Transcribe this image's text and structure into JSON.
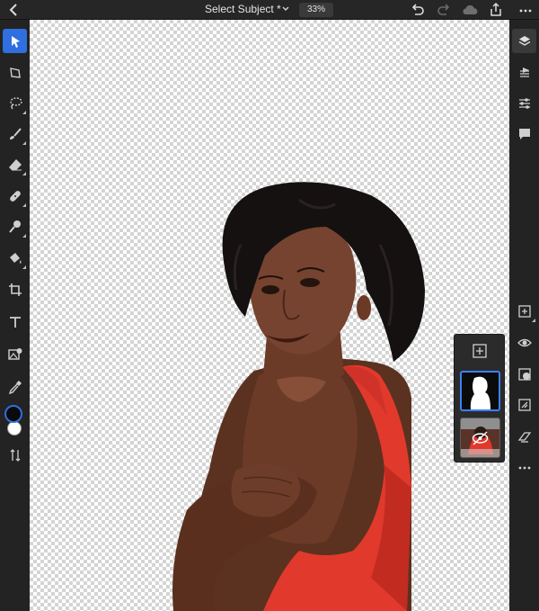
{
  "top_bar": {
    "document_title": "Select Subject *",
    "zoom_level": "33%",
    "back_icon": "chevron-left-icon",
    "title_menu_icon": "chevron-down-icon",
    "undo_icon": "undo-icon",
    "redo_icon": "redo-icon",
    "cloud_icon": "cloud-icon",
    "share_icon": "share-icon",
    "more_icon": "more-horizontal-icon"
  },
  "left_toolbar": {
    "tools": [
      "move-tool-icon",
      "transform-tool-icon",
      "lasso-tool-icon",
      "brush-tool-icon",
      "eraser-tool-icon",
      "healing-tool-icon",
      "clone-stamp-tool-icon",
      "fill-tool-icon",
      "crop-tool-icon",
      "type-tool-icon",
      "place-image-icon",
      "eyedropper-icon",
      "color-swatch-foreground",
      "color-swatch-background",
      "swap-colors-icon"
    ],
    "active_tool": "move-tool-icon",
    "foreground_color": "#0a0a0a",
    "background_color": "#ffffff"
  },
  "right_toolbar": {
    "tools": [
      "layers-icon",
      "layer-properties-icon",
      "adjustments-icon",
      "comments-icon",
      "add-layer-icon",
      "visibility-icon",
      "mask-icon",
      "clipping-icon",
      "fx-icon",
      "more-vertical-icon"
    ],
    "active_tool": "layers-icon"
  },
  "layers_panel": {
    "add_icon": "add-layer-icon",
    "layers": [
      {
        "name": "mask-layer",
        "selected": true,
        "hidden": false
      },
      {
        "name": "photo-layer",
        "selected": false,
        "hidden": true
      }
    ]
  },
  "colors": {
    "accent": "#2f6fe0",
    "dress": "#e1392c",
    "skin": "#6b3b28",
    "hair": "#141110"
  }
}
